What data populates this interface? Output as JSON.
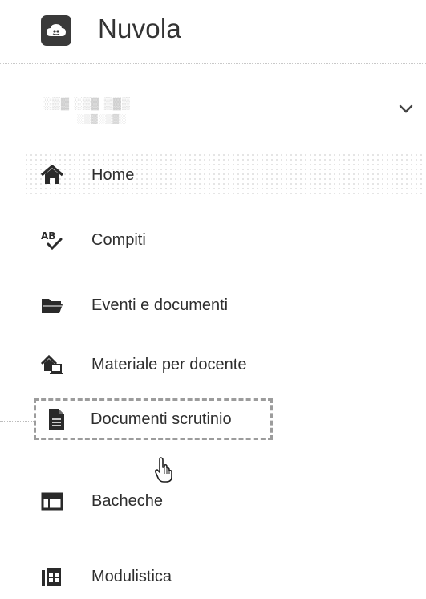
{
  "app": {
    "title": "Nuvola",
    "logo_icon": "cloud-logo-icon"
  },
  "user": {
    "line1": "░▒▓ ░▒▓ ▒▓▒",
    "line2": "░▒▓░▒▓░",
    "toggle_icon": "chevron-down-icon"
  },
  "nav": {
    "items": [
      {
        "label": "Home",
        "icon": "home-icon"
      },
      {
        "label": "Compiti",
        "icon": "spellcheck-icon"
      },
      {
        "label": "Eventi e documenti",
        "icon": "folder-open-icon"
      },
      {
        "label": "Materiale per docente",
        "icon": "house-laptop-icon"
      },
      {
        "label": "Documenti scrutinio",
        "icon": "file-icon"
      },
      {
        "label": "Bacheche",
        "icon": "calendar-board-icon"
      },
      {
        "label": "Modulistica",
        "icon": "forms-icon"
      }
    ],
    "active_index": 4
  },
  "colors": {
    "text": "#2e2e2e",
    "logo_bg": "#3a3a3a",
    "active_border": "#9c9c9c"
  }
}
